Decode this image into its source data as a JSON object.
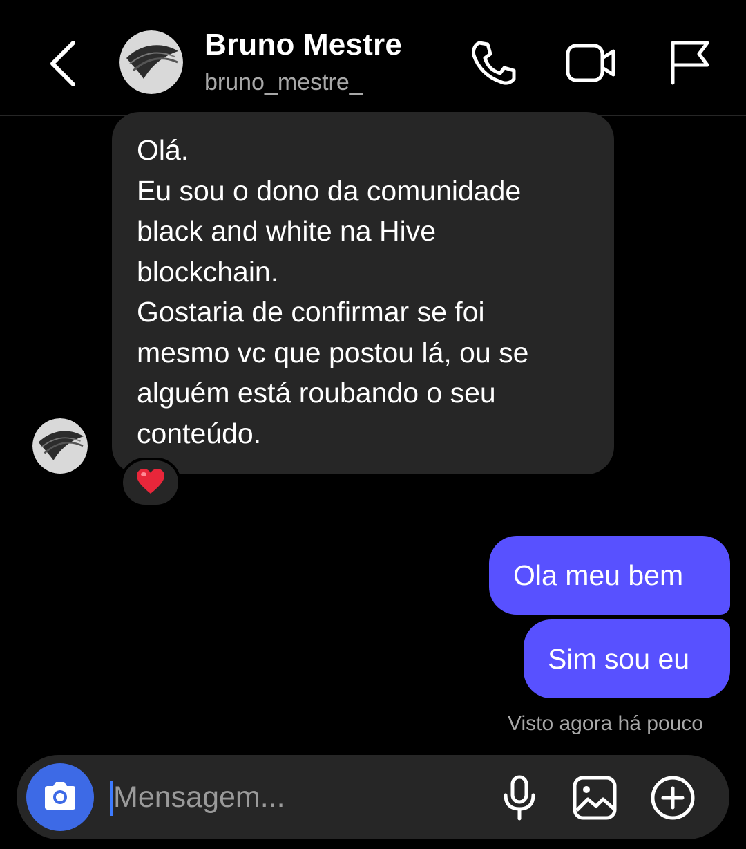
{
  "header": {
    "name": "Bruno Mestre",
    "handle": "bruno_mestre_",
    "icons": [
      "back-chevron-icon",
      "phone-icon",
      "video-camera-icon",
      "flag-icon"
    ]
  },
  "thread": {
    "incoming": {
      "lines": [
        "Olá.",
        "Eu sou o dono da comunidade",
        "black and white na Hive",
        "blockchain.",
        "Gostaria de confirmar se foi",
        "mesmo vc que postou lá, ou se",
        "alguém está roubando o seu",
        "conteúdo."
      ],
      "reaction": "❤️"
    },
    "outgoing": [
      "Ola meu bem",
      "Sim sou eu"
    ],
    "seen_status": "Visto agora há pouco"
  },
  "composer": {
    "placeholder": "Mensagem...",
    "icons": [
      "camera-icon",
      "microphone-icon",
      "gallery-icon",
      "plus-circle-icon"
    ]
  },
  "colors": {
    "background": "#000000",
    "incoming_bubble": "#262626",
    "outgoing_bubble": "#5851ff",
    "camera_button": "#3d6ae6",
    "secondary_text": "#a8a8a8"
  }
}
